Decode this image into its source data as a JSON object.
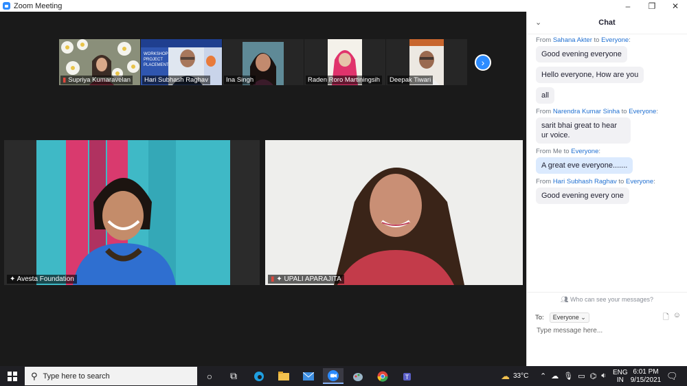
{
  "window": {
    "title": "Zoom Meeting",
    "controls": [
      "–",
      "❐",
      "✕"
    ]
  },
  "thumbnails": [
    {
      "name": "Supriya Kumaravelan",
      "muted": true
    },
    {
      "name": "Hari Subhash Raghav",
      "muted": false
    },
    {
      "name": "Ina Singh",
      "muted": false
    },
    {
      "name": "Raden Roro Martiningsih",
      "muted": false
    },
    {
      "name": "Deepak Tiwari",
      "muted": false
    }
  ],
  "thumb_banner_text": "WORKSHOP PROJECT PLACEMENT",
  "main_videos": [
    {
      "name": "Avesta Foundation",
      "pinned": true
    },
    {
      "name": "UPALI APARAJITA",
      "pinned": true,
      "muted": true
    }
  ],
  "chat": {
    "title": "Chat",
    "messages": [
      {
        "from": "Sahana Akter",
        "to": "Everyone",
        "texts": [
          "Good evening everyone",
          "Hello everyone, How are you",
          "all"
        ]
      },
      {
        "from": "Narendra Kumar Sinha",
        "to": "Everyone",
        "texts": [
          "sarit bhai great to hear ur voice."
        ]
      },
      {
        "from": "Me",
        "to": "Everyone",
        "texts": [
          "A great eve everyone......."
        ]
      },
      {
        "from": "Hari Subhash Raghav",
        "to": "Everyone",
        "texts": [
          "Good evening every one"
        ]
      }
    ],
    "from_word": "From",
    "to_word": "to",
    "who_can_see": "Who can see your messages?",
    "to_label": "To:",
    "to_value": "Everyone",
    "input_placeholder": "Type message here..."
  },
  "taskbar": {
    "search_placeholder": "Type here to search",
    "weather": "33°C",
    "language": "ENG",
    "region": "IN",
    "time": "6:01 PM",
    "date": "9/15/2021"
  },
  "colors": {
    "accent": "#2d8cff",
    "chat_name": "#1f6fd1",
    "muted": "#e0473c"
  }
}
